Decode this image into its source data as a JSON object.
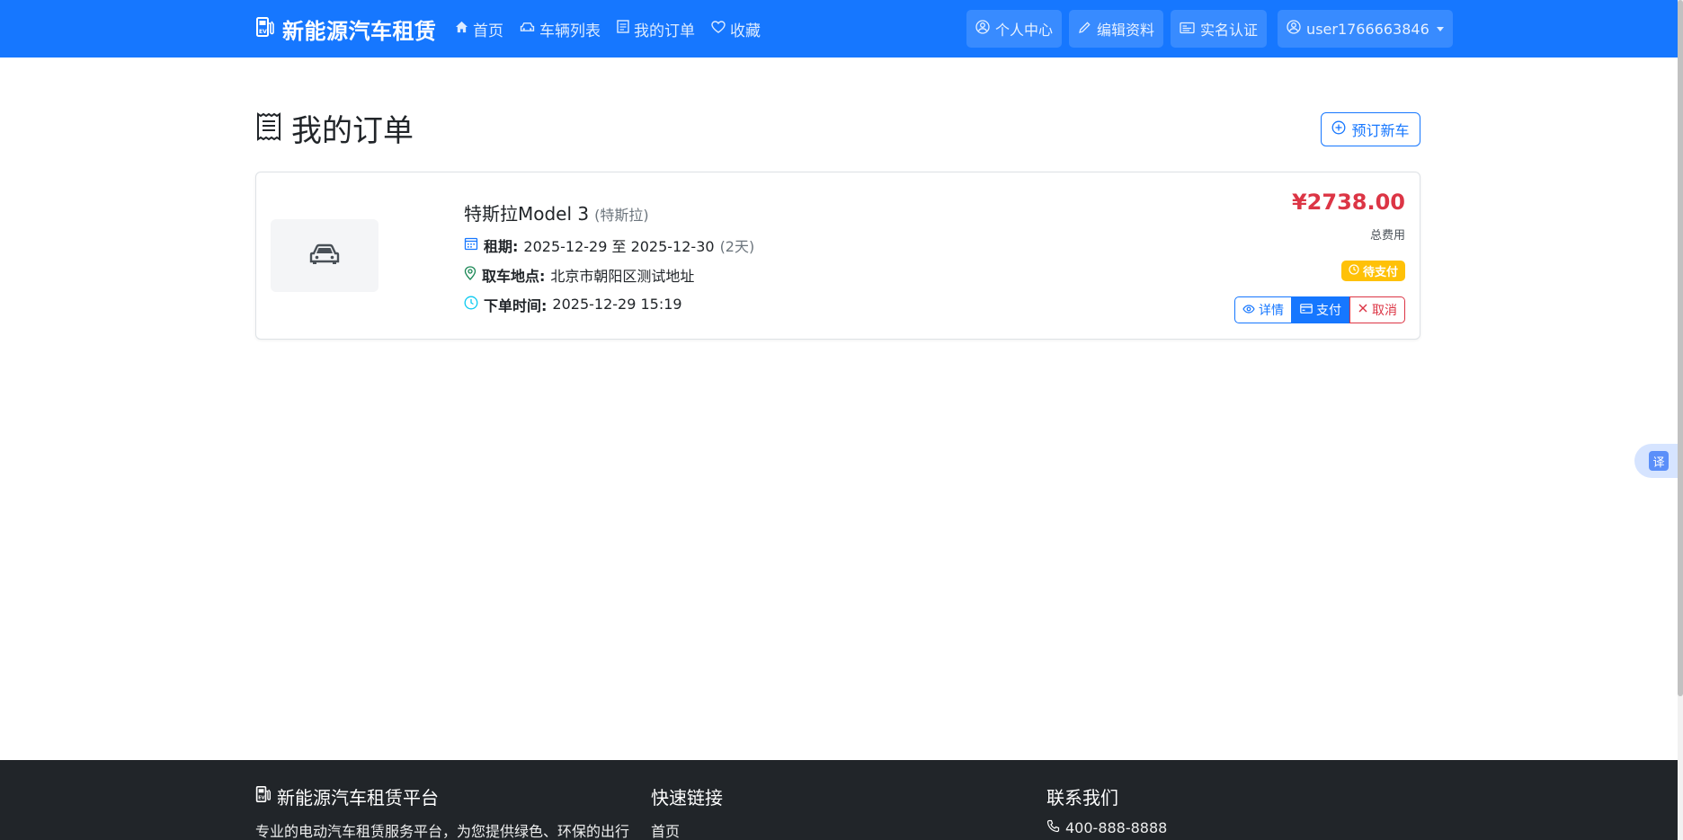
{
  "navbar": {
    "brand": "新能源汽车租赁",
    "links": [
      {
        "label": "首页",
        "icon": "house-icon"
      },
      {
        "label": "车辆列表",
        "icon": "car-icon"
      },
      {
        "label": "我的订单",
        "icon": "receipt-icon"
      },
      {
        "label": "收藏",
        "icon": "heart-icon"
      }
    ],
    "right": [
      {
        "label": "个人中心",
        "icon": "person-circle-icon"
      },
      {
        "label": "编辑资料",
        "icon": "pencil-icon"
      },
      {
        "label": "实名认证",
        "icon": "id-card-icon"
      }
    ],
    "user": "user1766663846"
  },
  "page": {
    "title": "我的订单",
    "new_order_button": "预订新车"
  },
  "order": {
    "car_name": "特斯拉Model 3",
    "car_brand": "(特斯拉)",
    "rental_label": "租期:",
    "rental_value": "2025-12-29 至 2025-12-30",
    "rental_days": "(2天)",
    "pickup_label": "取车地点:",
    "pickup_value": "北京市朝阳区测试地址",
    "order_time_label": "下单时间:",
    "order_time_value": "2025-12-29 15:19",
    "price": "¥2738.00",
    "price_label": "总费用",
    "status": "待支付",
    "actions": {
      "detail": "详情",
      "pay": "支付",
      "cancel": "取消"
    }
  },
  "translate": {
    "label": "译"
  },
  "footer": {
    "col1_title": "新能源汽车租赁平台",
    "col1_text": "专业的电动汽车租赁服务平台，为您提供绿色、环保的出行",
    "col2_title": "快速链接",
    "col2_link": "首页",
    "col3_title": "联系我们",
    "col3_phone": "400-888-8888"
  },
  "colors": {
    "primary": "#1677ff",
    "danger": "#dc3545",
    "warning": "#ffc107",
    "footer_bg": "#212529"
  }
}
